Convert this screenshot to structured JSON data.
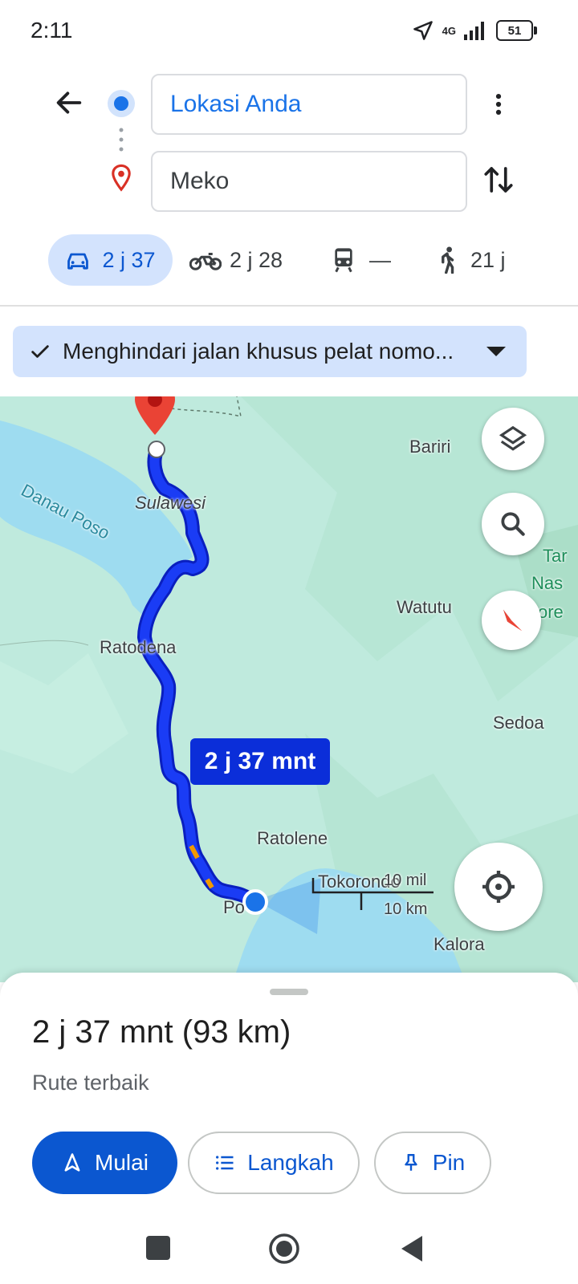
{
  "status_bar": {
    "time": "2:11",
    "network": "4G",
    "battery": "51"
  },
  "header": {
    "origin": "Lokasi Anda",
    "destination": "Meko"
  },
  "modes": [
    {
      "name": "car",
      "time": "2 j 37"
    },
    {
      "name": "motorcycle",
      "time": "2 j 28"
    },
    {
      "name": "transit",
      "time": "—"
    },
    {
      "name": "walk",
      "time": "21 j"
    }
  ],
  "filter_chip": {
    "label": "Menghindari jalan khusus pelat nomo..."
  },
  "map": {
    "labels": {
      "danau_poso": "Danau Poso",
      "sulawesi": "Sulawesi",
      "bariri": "Bariri",
      "watutu": "Watutu",
      "ratodena": "Ratodena",
      "sedoa": "Sedoa",
      "ratolene": "Ratolene",
      "tokoronda": "Tokorondo",
      "kalora": "Kalora",
      "poso": "Po",
      "park_line1": "Tar",
      "park_line2": "Nas",
      "park_line3": "ore"
    },
    "eta_bubble": "2 j 37 mnt",
    "scale": {
      "imperial": "10 mil",
      "metric": "10 km"
    },
    "colors": {
      "route": "#1a3cf5",
      "water": "#9edcf0",
      "land": "#bfeadd"
    }
  },
  "sheet": {
    "summary": "2 j 37 mnt (93 km)",
    "route_label": "Rute terbaik",
    "buttons": {
      "start": "Mulai",
      "steps": "Langkah",
      "pin": "Pin"
    }
  },
  "icons": [
    "back-arrow-icon",
    "origin-dot-icon",
    "destination-pin-icon",
    "more-vert-icon",
    "swap-icon",
    "car-icon",
    "motorcycle-icon",
    "transit-icon",
    "walk-icon",
    "check-icon",
    "layers-icon",
    "search-icon",
    "compass-icon",
    "my-location-icon",
    "navigation-icon",
    "list-icon",
    "pin-icon"
  ]
}
